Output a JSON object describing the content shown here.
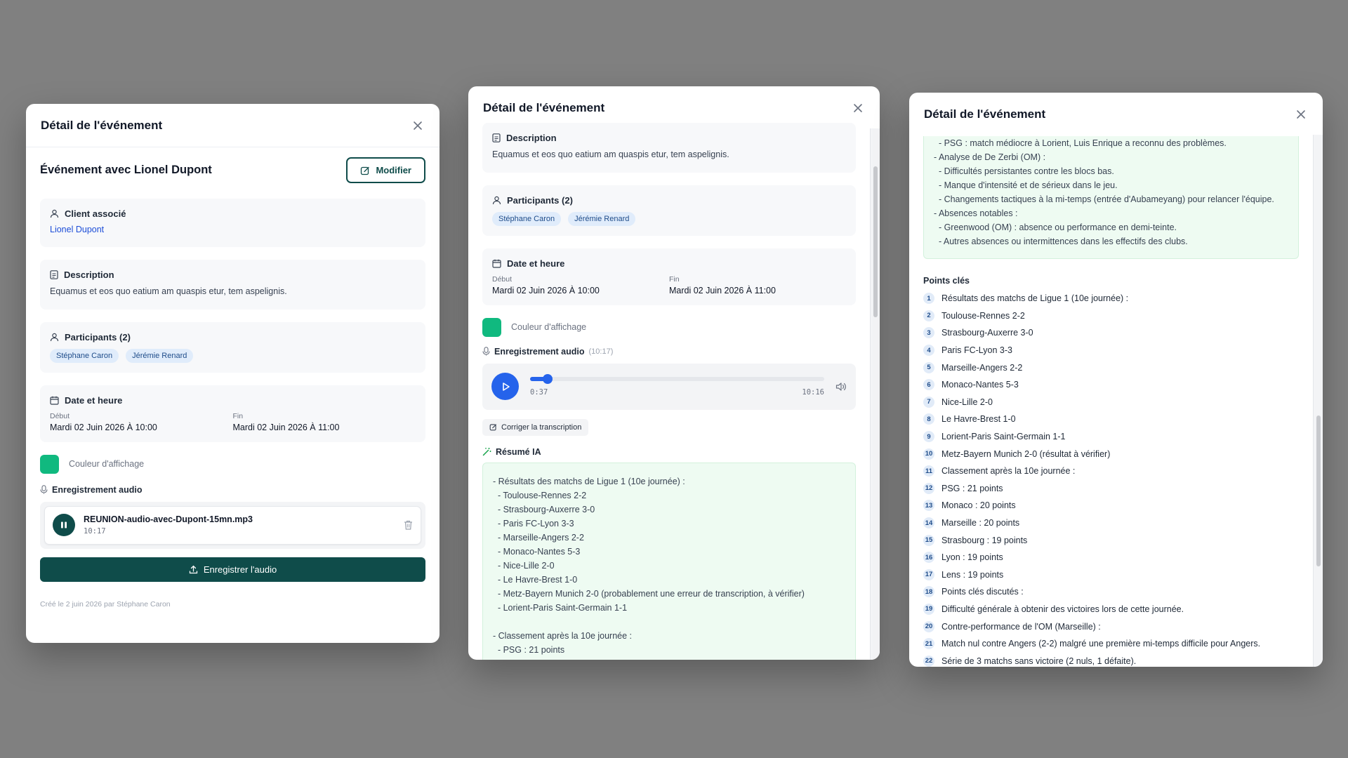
{
  "modal_title": "Détail de l'événement",
  "panel1": {
    "event_title": "Événement avec Lionel Dupont",
    "modify_label": "Modifier",
    "client_heading": "Client associé",
    "client_name": "Lionel Dupont",
    "description_heading": "Description",
    "description_text": "Equamus et eos quo eatium am quaspis etur, tem aspelignis.",
    "participants_heading": "Participants (2)",
    "participants": [
      "Stéphane Caron",
      "Jérémie Renard"
    ],
    "datetime_heading": "Date et heure",
    "start_label": "Début",
    "start_value": "Mardi 02 Juin 2026 À 10:00",
    "end_label": "Fin",
    "end_value": "Mardi 02 Juin 2026 À 11:00",
    "color_label": "Couleur d'affichage",
    "audio_heading": "Enregistrement audio",
    "file_name": "REUNION-audio-avec-Dupont-15mn.mp3",
    "file_duration": "10:17",
    "record_label": "Enregistrer l'audio",
    "footer": "Créé le 2 juin 2026 par Stéphane Caron"
  },
  "panel2": {
    "description_heading": "Description",
    "description_text": "Equamus et eos quo eatium am quaspis etur, tem aspelignis.",
    "participants_heading": "Participants (2)",
    "participants": [
      "Stéphane Caron",
      "Jérémie Renard"
    ],
    "datetime_heading": "Date et heure",
    "start_label": "Début",
    "start_value": "Mardi 02 Juin 2026 À 10:00",
    "end_label": "Fin",
    "end_value": "Mardi 02 Juin 2026 À 11:00",
    "color_label": "Couleur d'affichage",
    "audio_heading": "Enregistrement audio",
    "audio_duration_hint": "(10:17)",
    "player_current": "0:37",
    "player_total": "10:16",
    "player_progress": 0.06,
    "correct_label": "Corriger la transcription",
    "summary_heading": "Résumé IA",
    "summary_text": "- Résultats des matchs de Ligue 1 (10e journée) :\n  - Toulouse-Rennes 2-2\n  - Strasbourg-Auxerre 3-0\n  - Paris FC-Lyon 3-3\n  - Marseille-Angers 2-2\n  - Monaco-Nantes 5-3\n  - Nice-Lille 2-0\n  - Le Havre-Brest 1-0\n  - Metz-Bayern Munich 2-0 (probablement une erreur de transcription, à vérifier)\n  - Lorient-Paris Saint-Germain 1-1\n\n- Classement après la 10e journée :\n  - PSG : 21 points"
  },
  "panel3": {
    "summary_tail": "  - PSG : match médiocre à Lorient, Luis Enrique a reconnu des problèmes.\n- Analyse de De Zerbi (OM) :\n  - Difficultés persistantes contre les blocs bas.\n  - Manque d'intensité et de sérieux dans le jeu.\n  - Changements tactiques à la mi-temps (entrée d'Aubameyang) pour relancer l'équipe.\n- Absences notables :\n  - Greenwood (OM) : absence ou performance en demi-teinte.\n  - Autres absences ou intermittences dans les effectifs des clubs.",
    "key_points_heading": "Points clés",
    "key_points": [
      "Résultats des matchs de Ligue 1 (10e journée) :",
      "Toulouse-Rennes 2-2",
      "Strasbourg-Auxerre 3-0",
      "Paris FC-Lyon 3-3",
      "Marseille-Angers 2-2",
      "Monaco-Nantes 5-3",
      "Nice-Lille 2-0",
      "Le Havre-Brest 1-0",
      "Lorient-Paris Saint-Germain 1-1",
      "Metz-Bayern Munich 2-0 (résultat à vérifier)",
      "Classement après la 10e journée :",
      "PSG : 21 points",
      "Monaco : 20 points",
      "Marseille : 20 points",
      "Strasbourg : 19 points",
      "Lyon : 19 points",
      "Lens : 19 points",
      "Points clés discutés :",
      "Difficulté générale à obtenir des victoires lors de cette journée.",
      "Contre-performance de l'OM (Marseille) :",
      "Match nul contre Angers (2-2) malgré une première mi-temps difficile pour Angers.",
      "Série de 3 matchs sans victoire (2 nuls, 1 défaite)."
    ]
  },
  "colors": {
    "accent": "#0f4c4a",
    "swatch": "#10b97f",
    "play": "#2563eb"
  }
}
